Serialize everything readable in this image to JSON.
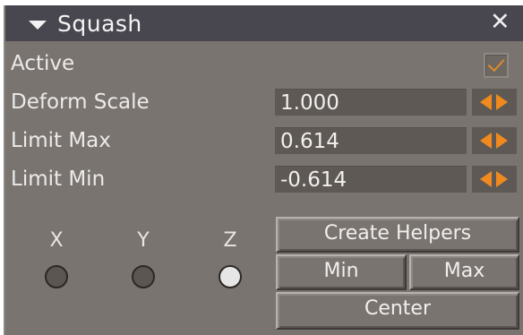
{
  "title": {
    "expand_icon": "triangle-down-icon",
    "label": "Squash",
    "close_icon": "close-icon",
    "close_glyph": "✕"
  },
  "rows": {
    "active": {
      "label": "Active",
      "checked": true
    },
    "deform_scale": {
      "label": "Deform Scale",
      "value": "1.000"
    },
    "limit_max": {
      "label": "Limit Max",
      "value": "0.614"
    },
    "limit_min": {
      "label": "Limit Min",
      "value": "-0.614"
    }
  },
  "axes": [
    {
      "label": "X",
      "state": "off"
    },
    {
      "label": "Y",
      "state": "off"
    },
    {
      "label": "Z",
      "state": "on"
    }
  ],
  "buttons": {
    "create_helpers": "Create Helpers",
    "min": "Min",
    "max": "Max",
    "center": "Center"
  },
  "colors": {
    "panel_bg": "#7a7470",
    "titlebar_bg": "#48464f",
    "field_bg": "#5e5955",
    "accent_orange": "#f08a1e"
  }
}
